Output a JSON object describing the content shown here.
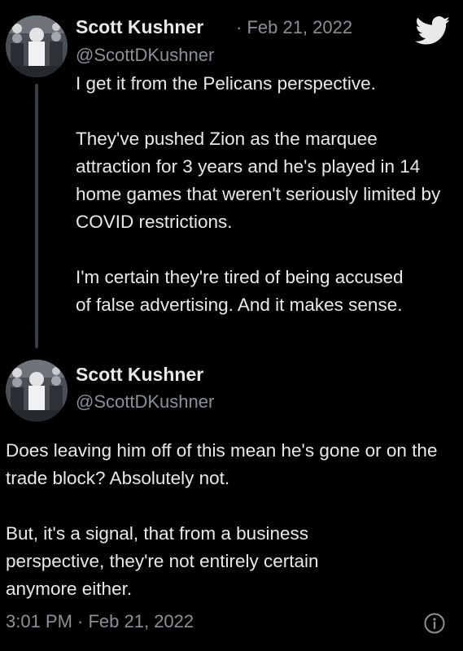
{
  "first_tweet": {
    "author_name": "Scott Kushner",
    "handle": "@ScottDKushner",
    "date": "· Feb 21, 2022",
    "paragraphs": [
      "I get it from the Pelicans perspective.",
      "They've pushed Zion as the marquee attraction for 3 years and he's played in 14 home games that weren't seriously limited by COVID restrictions.",
      "I'm certain they're tired of being accused of false advertising. And it makes sense."
    ]
  },
  "reply_tweet": {
    "author_name": "Scott Kushner",
    "handle": "@ScottDKushner",
    "paragraphs": [
      "Does leaving him off of this mean he's gone or on the trade block? Absolutely not.",
      "But, it's a signal, that from a business perspective, they're not entirely certain anymore either."
    ],
    "timestamp": "3:01 PM · Feb 21, 2022"
  },
  "icons": {
    "brand": "twitter-bird-icon",
    "info": "info-icon"
  },
  "colors": {
    "background": "#000000",
    "text": "#e7e9ea",
    "secondary_text": "#8b9096",
    "thread_line": "#3a3d42"
  }
}
